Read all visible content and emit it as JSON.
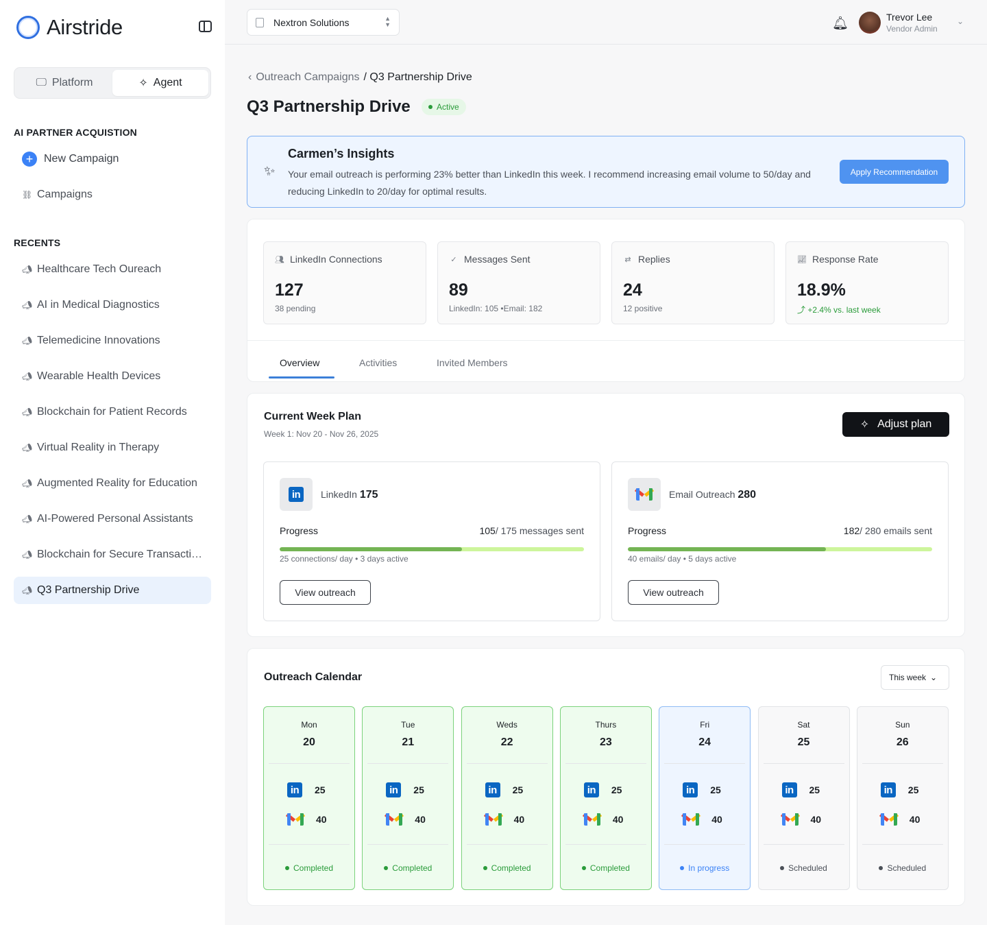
{
  "brand": {
    "name": "Airstride"
  },
  "mode_switch": {
    "platform": "Platform",
    "agent": "Agent"
  },
  "sidebar": {
    "section_title": "AI PARTNER ACQUISTION",
    "new_campaign": "New Campaign",
    "campaigns": "Campaigns",
    "recents_title": "RECENTS",
    "recents": [
      "Healthcare Tech Oureach",
      "AI in Medical Diagnostics",
      "Telemedicine Innovations",
      "Wearable Health Devices",
      "Blockchain for Patient Records",
      "Virtual Reality in Therapy",
      "Augmented Reality for Education",
      "AI-Powered Personal Assistants",
      "Blockchain for Secure Transactions",
      "Q3 Partnership Drive"
    ]
  },
  "topbar": {
    "org": "Nextron Solutions",
    "user_name": "Trevor Lee",
    "user_role": "Vendor Admin"
  },
  "breadcrumb": {
    "parent": "Outreach Campaigns",
    "current": "/ Q3 Partnership Drive"
  },
  "page": {
    "title": "Q3 Partnership Drive",
    "status": "Active"
  },
  "insight": {
    "title": "Carmen’s Insights",
    "text": "Your email outreach is performing 23% better than LinkedIn this week. I recommend increasing email volume to 50/day and reducing LinkedIn to 20/day for optimal results.",
    "button": "Apply Recommendation"
  },
  "stats": [
    {
      "label": "LinkedIn Connections",
      "value": "127",
      "sub": "38 pending"
    },
    {
      "label": "Messages Sent",
      "value": "89",
      "sub": "LinkedIn: 105 •Email: 182"
    },
    {
      "label": "Replies",
      "value": "24",
      "sub": "12 positive"
    },
    {
      "label": "Response Rate",
      "value": "18.9%",
      "sub": "+2.4% vs. last week"
    }
  ],
  "tabs": [
    "Overview",
    "Activities",
    "Invited Members"
  ],
  "plan": {
    "title": "Current Week Plan",
    "subtitle": "Week 1: Nov 20 - Nov 26, 2025",
    "adjust": "Adjust plan",
    "channels": [
      {
        "name": "LinkedIn",
        "total": "175",
        "progress_label": "Progress",
        "done": "105",
        "count_text": "/ 175 messages sent",
        "fraction": 0.6,
        "meta": "25 connections/ day • 3 days active",
        "button": "View outreach"
      },
      {
        "name": "Email Outreach",
        "total": "280",
        "progress_label": "Progress",
        "done": "182",
        "count_text": "/ 280 emails sent",
        "fraction": 0.65,
        "meta": "40 emails/ day • 5 days active",
        "button": "View outreach"
      }
    ]
  },
  "calendar": {
    "title": "Outreach Calendar",
    "range": "This week",
    "days": [
      {
        "name": "Mon",
        "num": "20",
        "linkedin": "25",
        "email": "40",
        "status": "Completed"
      },
      {
        "name": "Tue",
        "num": "21",
        "linkedin": "25",
        "email": "40",
        "status": "Completed"
      },
      {
        "name": "Weds",
        "num": "22",
        "linkedin": "25",
        "email": "40",
        "status": "Completed"
      },
      {
        "name": "Thurs",
        "num": "23",
        "linkedin": "25",
        "email": "40",
        "status": "Completed"
      },
      {
        "name": "Fri",
        "num": "24",
        "linkedin": "25",
        "email": "40",
        "status": "In progress"
      },
      {
        "name": "Sat",
        "num": "25",
        "linkedin": "25",
        "email": "40",
        "status": "Scheduled"
      },
      {
        "name": "Sun",
        "num": "26",
        "linkedin": "25",
        "email": "40",
        "status": "Scheduled"
      }
    ]
  },
  "colors": {
    "accent": "#3b82f6",
    "success": "#2a9b3a",
    "progress_fill": "#74b454",
    "progress_track": "#cdf59c"
  }
}
